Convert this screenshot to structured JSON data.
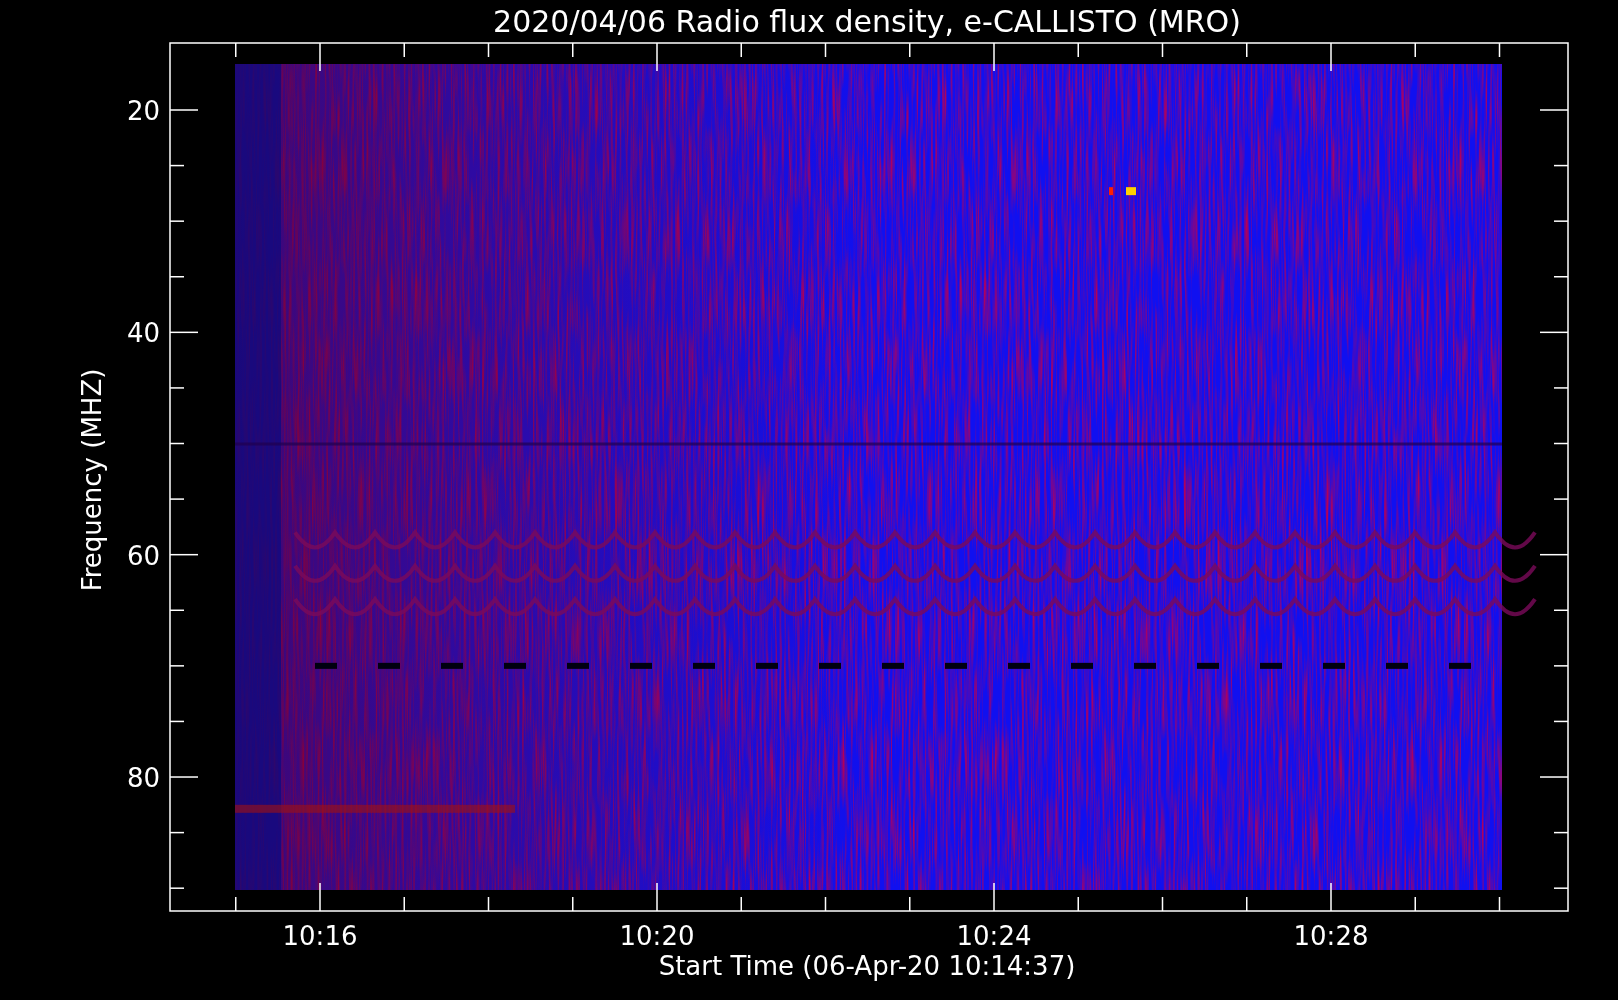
{
  "title": "2020/04/06  Radio flux density, e-CALLISTO (MRO)",
  "y_axis": {
    "label": "Frequency (MHZ)",
    "ticks": [
      "20",
      "40",
      "60",
      "80"
    ]
  },
  "x_axis": {
    "label": "Start Time (06-Apr-20 10:14:37)",
    "ticks": [
      "10:16",
      "10:20",
      "10:24",
      "10:28"
    ]
  }
}
